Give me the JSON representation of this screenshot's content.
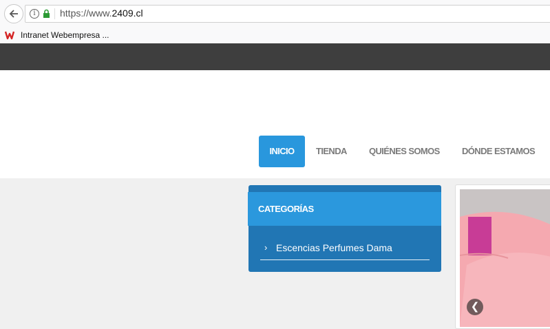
{
  "browser": {
    "url_prefix": "https://www.",
    "url_domain": "2409.cl",
    "bookmark_label": "Intranet Webempresa ..."
  },
  "nav": {
    "items": [
      "INICIO",
      "TIENDA",
      "QUIÉNES SOMOS",
      "DÓNDE ESTAMOS"
    ],
    "active_index": 0
  },
  "categories": {
    "title": "CATEGORÍAS",
    "items": [
      "Escencias Perfumes Dama"
    ]
  },
  "slider": {
    "prev_glyph": "❮"
  },
  "colors": {
    "accent": "#2997dd",
    "category_bg": "#2176b4",
    "topbar": "#3e3e3e"
  }
}
